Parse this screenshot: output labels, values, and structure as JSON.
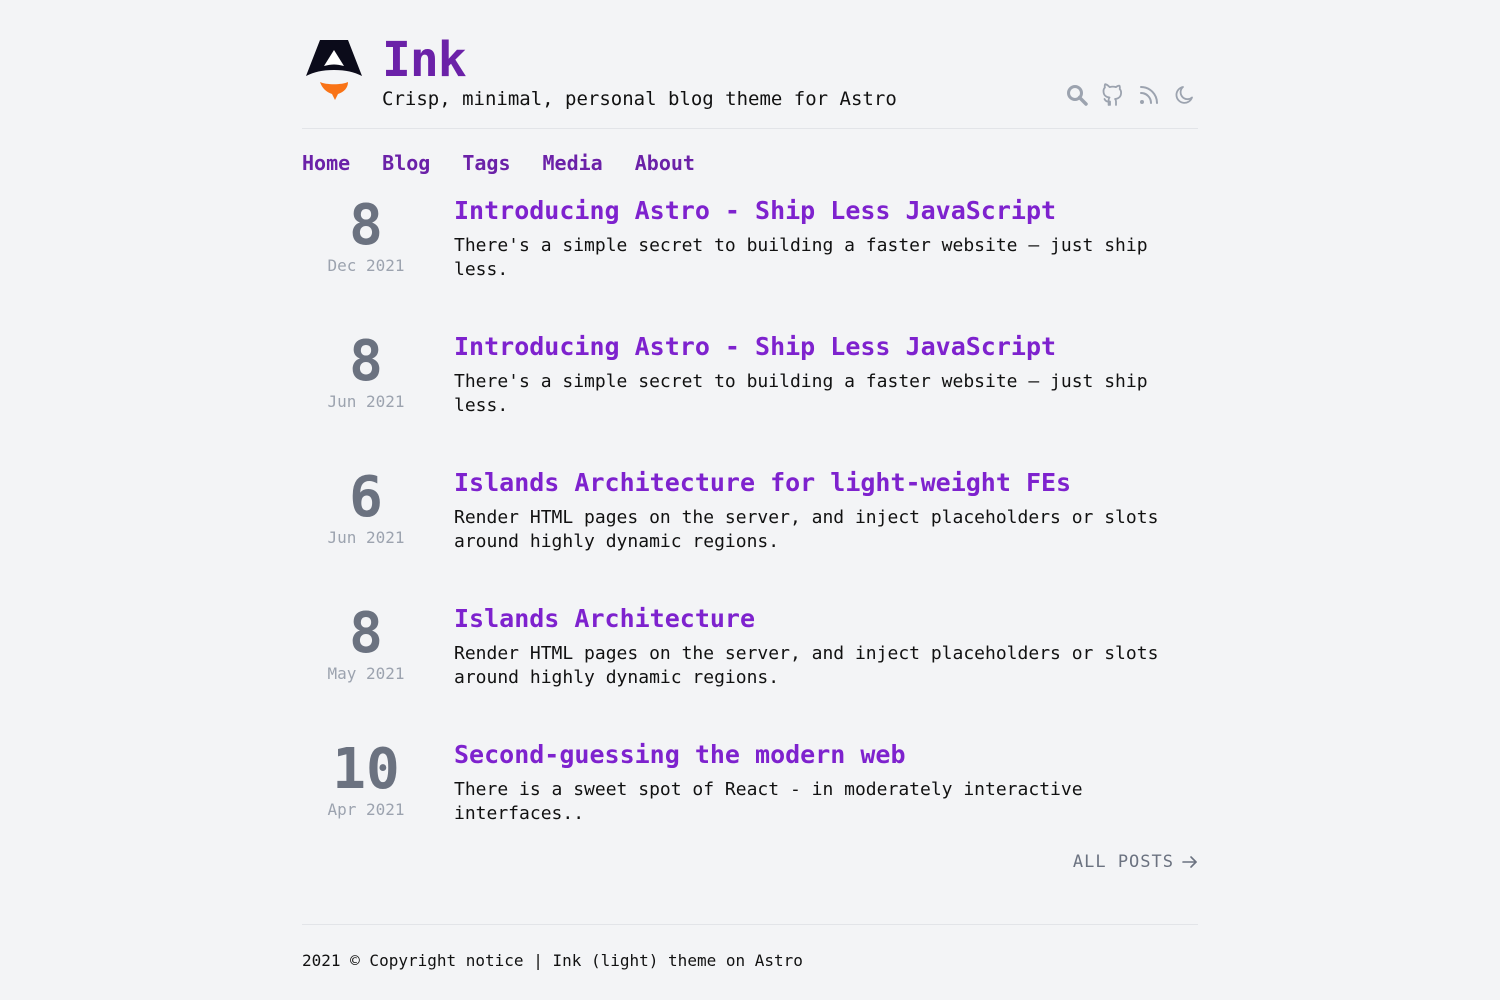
{
  "site": {
    "title": "Ink",
    "tagline": "Crisp, minimal, personal blog theme for Astro"
  },
  "header_icons": [
    "search-icon",
    "github-icon",
    "rss-icon",
    "moon-icon"
  ],
  "nav": {
    "items": [
      {
        "label": "Home"
      },
      {
        "label": "Blog"
      },
      {
        "label": "Tags"
      },
      {
        "label": "Media"
      },
      {
        "label": "About"
      }
    ]
  },
  "posts": [
    {
      "day": "8",
      "month_year": "Dec 2021",
      "title": "Introducing Astro - Ship Less JavaScript",
      "description": "There's a simple secret to building a faster website — just ship less."
    },
    {
      "day": "8",
      "month_year": "Jun 2021",
      "title": "Introducing Astro - Ship Less JavaScript",
      "description": "There's a simple secret to building a faster website — just ship less."
    },
    {
      "day": "6",
      "month_year": "Jun 2021",
      "title": "Islands Architecture for light-weight FEs",
      "description": "Render HTML pages on the server, and inject placeholders or slots around highly dynamic regions."
    },
    {
      "day": "8",
      "month_year": "May 2021",
      "title": "Islands Architecture",
      "description": "Render HTML pages on the server, and inject placeholders or slots around highly dynamic regions."
    },
    {
      "day": "10",
      "month_year": "Apr 2021",
      "title": "Second-guessing the modern web",
      "description": "There is a sweet spot of React - in moderately interactive interfaces.."
    }
  ],
  "all_posts_label": "ALL POSTS",
  "footer": {
    "text": "2021 © Copyright notice | Ink (light) theme on Astro"
  },
  "colors": {
    "accent": "#6b21a8",
    "title": "#7e22ce",
    "muted": "#6b7280",
    "background": "#f3f4f6"
  }
}
